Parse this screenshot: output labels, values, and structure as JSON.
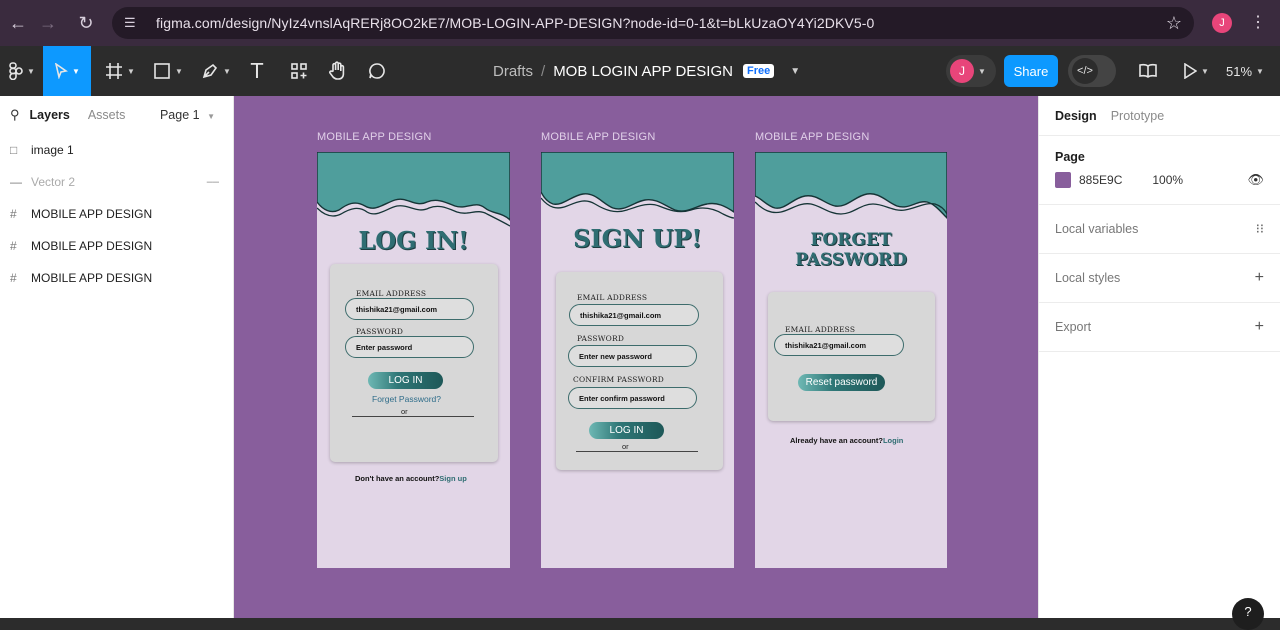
{
  "browser": {
    "url": "figma.com/design/NyIz4vnslAqRERj8OO2kE7/MOB-LOGIN-APP-DESIGN?node-id=0-1&t=bLkUzaOY4Yi2DKV5-0",
    "profile_initial": "J"
  },
  "toolbar": {
    "breadcrumb_drafts": "Drafts",
    "breadcrumb_sep": "/",
    "file_name": "MOB LOGIN APP DESIGN",
    "plan_badge": "Free",
    "avatar_initial": "J",
    "share_label": "Share",
    "zoom_label": "51%"
  },
  "left_panel": {
    "tabs": [
      "Layers",
      "Assets"
    ],
    "page_selector": "Page 1",
    "layers": [
      {
        "name": "image 1",
        "icon": "image-icon",
        "hidden": false
      },
      {
        "name": "Vector 2",
        "icon": "vector-icon",
        "hidden": true
      },
      {
        "name": "MOBILE APP DESIGN",
        "icon": "frame-icon",
        "hidden": false
      },
      {
        "name": "MOBILE APP DESIGN",
        "icon": "frame-icon",
        "hidden": false
      },
      {
        "name": "MOBILE APP DESIGN",
        "icon": "frame-icon",
        "hidden": false
      }
    ]
  },
  "canvas": {
    "background": "#885E9C",
    "frames": [
      {
        "label": "MOBILE APP DESIGN",
        "title": "LOG IN!",
        "email_label": "EMAIL ADDRESS",
        "email_value": "thishika21@gmail.com",
        "password_label": "PASSWORD",
        "password_placeholder": "Enter password",
        "button_label": "LOG IN",
        "forget_link": "Forget Password?",
        "or_text": "or",
        "bottom_text": "Don't have an account?",
        "bottom_link": "Sign up"
      },
      {
        "label": "MOBILE APP DESIGN",
        "title": "SIGN UP!",
        "email_label": "EMAIL ADDRESS",
        "email_value": "thishika21@gmail.com",
        "password_label": "PASSWORD",
        "password_placeholder": "Enter new password",
        "confirm_label": "CONFIRM PASSWORD",
        "confirm_placeholder": "Enter confirm password",
        "button_label": "LOG IN",
        "or_text": "or"
      },
      {
        "label": "MOBILE APP DESIGN",
        "title": "FORGET PASSWORD",
        "email_label": "EMAIL ADDRESS",
        "email_value": "thishika21@gmail.com",
        "button_label": "Reset password",
        "bottom_text": "Already have an account?",
        "bottom_link": "Login"
      }
    ]
  },
  "right_panel": {
    "tabs": [
      "Design",
      "Prototype"
    ],
    "page_heading": "Page",
    "page_color_hex": "885E9C",
    "page_color_opacity": "100%",
    "sections": [
      "Local variables",
      "Local styles",
      "Export"
    ]
  },
  "help_label": "?"
}
